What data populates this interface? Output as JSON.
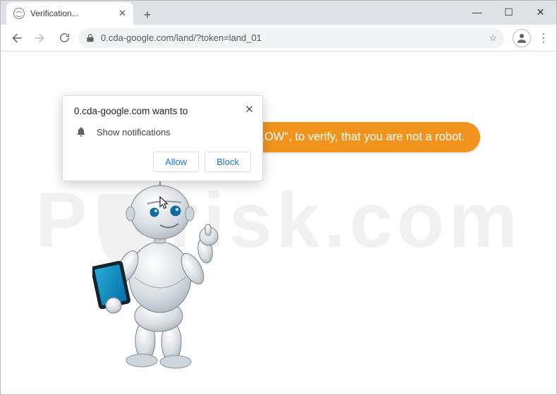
{
  "window": {
    "tab_title": "Verification...",
    "url": "0.cda-google.com/land/?token=land_01"
  },
  "permission_prompt": {
    "origin_text": "0.cda-google.com wants to",
    "permission_label": "Show notifications",
    "allow_label": "Allow",
    "block_label": "Block"
  },
  "page": {
    "speech_bubble_text": "Press \"ALLOW\", to verify, that you are not a robot.",
    "watermark_left": "P",
    "watermark_right": "risk.com"
  },
  "colors": {
    "accent_orange": "#f0941e",
    "chrome_blue": "#1a73e8",
    "tab_bg": "#dee1e6"
  }
}
